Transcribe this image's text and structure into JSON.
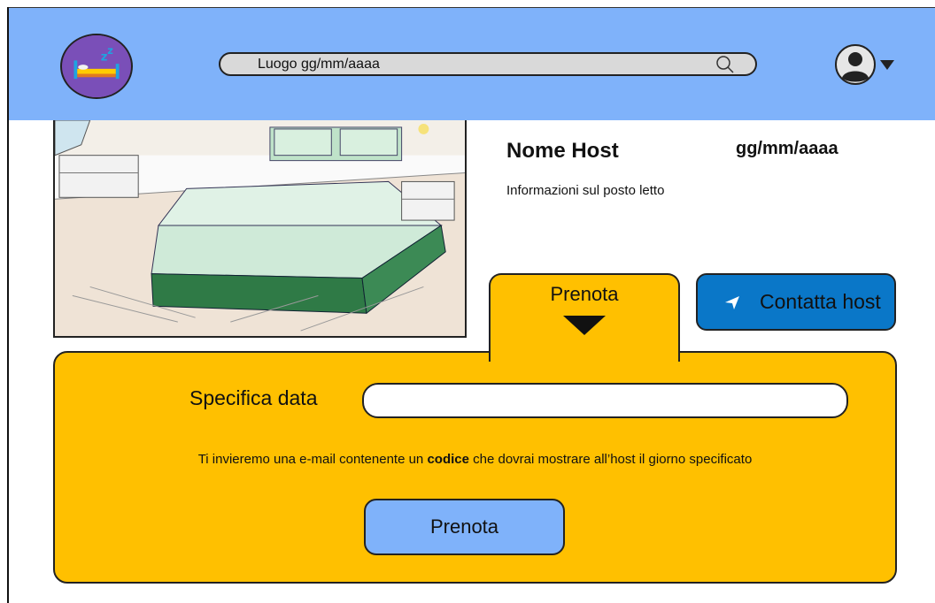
{
  "header": {
    "search": {
      "value": "Luogo gg/mm/aaaa",
      "icon": "search-icon"
    },
    "logo_icon": "bed-sleep-logo-icon",
    "user_icon": "user-avatar-icon",
    "user_caret_icon": "caret-down-icon",
    "background_color": "#7fb2fa"
  },
  "listing": {
    "host_name": "Nome Host",
    "date": "gg/mm/aaaa",
    "info": "Informazioni sul posto letto"
  },
  "tabs": {
    "prenota_label": "Prenota",
    "prenota_caret_icon": "caret-down-icon",
    "contact_label": "Contatta host",
    "contact_icon": "send-icon",
    "contact_color": "#0a77c8"
  },
  "booking": {
    "date_label": "Specifica data",
    "date_value": "",
    "notice_before": "Ti invieremo una e-mail contenente un ",
    "notice_bold": "codice",
    "notice_after": " che dovrai mostrare all’host il giorno specificato",
    "submit_label": "Prenota",
    "panel_color": "#ffc000"
  }
}
